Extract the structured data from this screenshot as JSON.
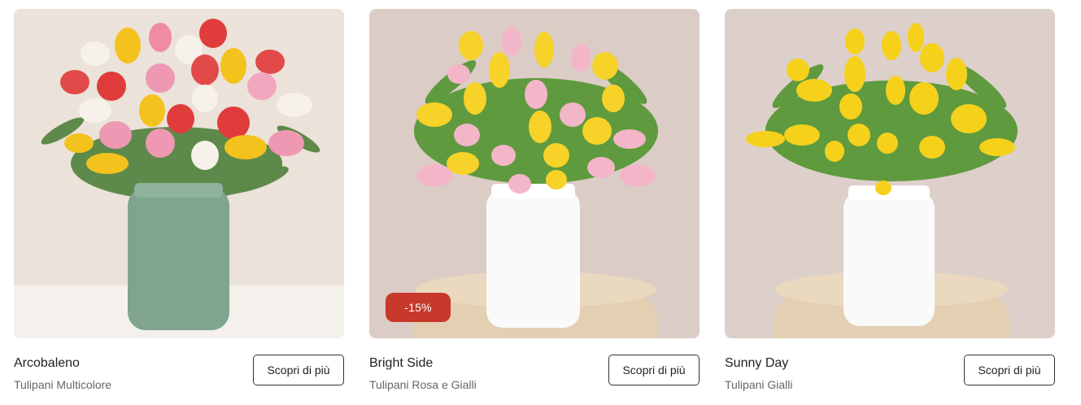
{
  "products": [
    {
      "name": "Arcobaleno",
      "subtitle": "Tulipani Multicolore",
      "cta": "Scopri di più",
      "image": "multicolor-tulips-in-green-vase",
      "colors": {
        "background": "#ebe2d9",
        "vase": "#7fa58e"
      }
    },
    {
      "name": "Bright Side",
      "subtitle": "Tulipani Rosa e Gialli",
      "cta": "Scopri di più",
      "badge": "-15%",
      "image": "pink-and-yellow-tulips-in-white-vase",
      "colors": {
        "background": "#dcccc6",
        "vase": "#ffffff",
        "badge": "#c7392b"
      }
    },
    {
      "name": "Sunny Day",
      "subtitle": "Tulipani Gialli",
      "cta": "Scopri di più",
      "image": "yellow-tulips-in-white-vase",
      "colors": {
        "background": "#ddd0ca",
        "vase": "#ffffff"
      }
    }
  ]
}
